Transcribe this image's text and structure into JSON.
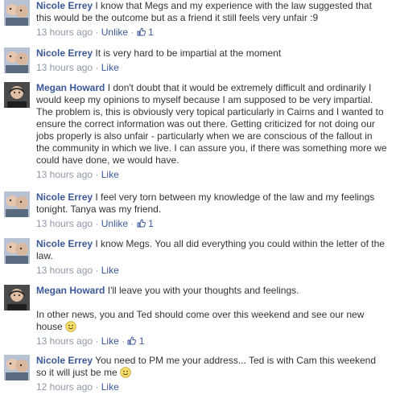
{
  "colors": {
    "name_link": "#3b5998",
    "meta_text": "#8e97a8",
    "body_text": "#333333"
  },
  "comments": [
    {
      "author": "Nicole Errey",
      "avatar": "avatar-nicole",
      "lines": [
        "I know that Megs and my experience with the law suggested that",
        "this would be the outcome but as a friend it still feels very unfair :9"
      ],
      "time": "13 hours ago",
      "action": "Unlike",
      "likes": "1"
    },
    {
      "author": "Nicole Errey",
      "avatar": "avatar-nicole",
      "lines": [
        "It is very hard to be impartial at the moment"
      ],
      "time": "13 hours ago",
      "action": "Like"
    },
    {
      "author": "Megan Howard",
      "avatar": "avatar-megan",
      "lines": [
        "I don't doubt that it would be extremely difficult and ordinarily I",
        "would keep my opinions to myself because I am supposed to be very impartial.",
        "The problem is, this is obviously very topical particularly in Cairns and I wanted to",
        "ensure the correct information was out there. Getting criticized for not doing our",
        "jobs properly is also unfair - particularly when we are conscious of the fallout in",
        "the community in which we live. I can assure you, if there was something more we",
        "could have done, we would have."
      ],
      "time": "13 hours ago",
      "action": "Like"
    },
    {
      "author": "Nicole Errey",
      "avatar": "avatar-nicole",
      "lines": [
        "I feel very torn between my knowledge of the law and my feelings",
        "tonight. Tanya was my friend."
      ],
      "time": "13 hours ago",
      "action": "Unlike",
      "likes": "1"
    },
    {
      "author": "Nicole Errey",
      "avatar": "avatar-nicole",
      "lines": [
        "I know Megs. You all did everything you could within the letter of the",
        "law."
      ],
      "time": "13 hours ago",
      "action": "Like"
    },
    {
      "author": "Megan Howard",
      "avatar": "avatar-megan",
      "lines": [
        "I'll leave you with your thoughts and feelings.",
        "",
        "In other news, you and Ted should come over this weekend and see our new",
        "house"
      ],
      "time": "13 hours ago",
      "action": "Like",
      "likes": "1"
    },
    {
      "author": "Nicole Errey",
      "avatar": "avatar-nicole",
      "lines": [
        "You need to PM me your address... Ted is with Cam this weekend",
        "so it will just be me"
      ],
      "time": "12 hours ago",
      "action": "Like"
    }
  ],
  "separator": " · "
}
